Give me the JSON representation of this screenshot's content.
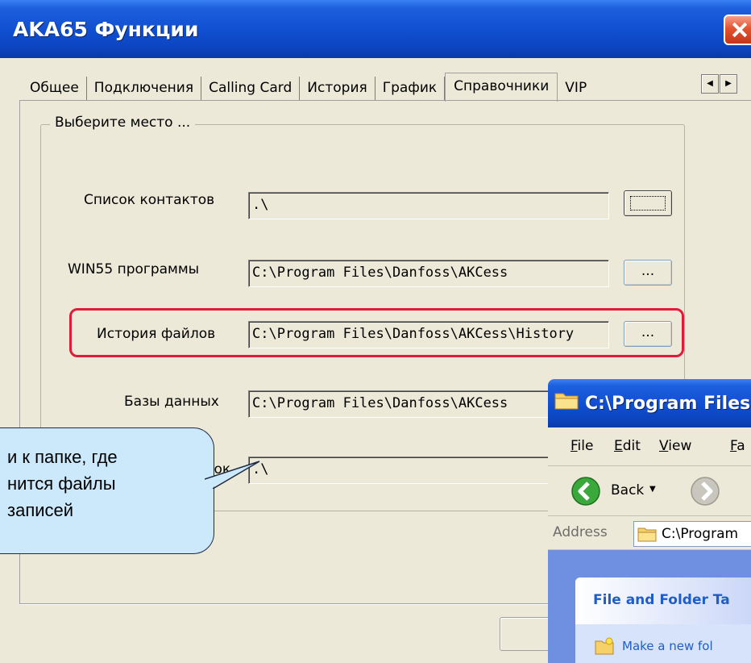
{
  "dialog": {
    "title": "AKA65 Функции",
    "tabs": [
      "Общее",
      "Подключения",
      "Calling Card",
      "История",
      "График",
      "Справочники",
      "VIP"
    ],
    "active_tab": "Справочники",
    "group_title": "Выберите место ...",
    "rows": [
      {
        "label": "Список контактов",
        "value": ".\\",
        "button": ""
      },
      {
        "label": "WIN55 программы",
        "value": "C:\\Program Files\\Danfoss\\AKCess",
        "button": "..."
      },
      {
        "label": "История файлов",
        "value": "C:\\Program Files\\Danfoss\\AKCess\\History",
        "button": "..."
      },
      {
        "label": "Базы данных",
        "value": "C:\\Program Files\\Danfoss\\AKCess",
        "button": ""
      },
      {
        "label": "писок",
        "value": ".\\",
        "button": ""
      }
    ]
  },
  "callout": {
    "lines": [
      "и к папке, где",
      "нится файлы",
      " записей"
    ],
    "color": "#cce8fb"
  },
  "explorer": {
    "title": "C:\\Program Files",
    "menu": [
      {
        "label": "File",
        "underline": "F",
        "rest": "ile"
      },
      {
        "label": "Edit",
        "underline": "E",
        "rest": "dit"
      },
      {
        "label": "View",
        "underline": "V",
        "rest": "iew"
      },
      {
        "label": "Fa",
        "underline": "F",
        "rest": "a"
      }
    ],
    "back_label": "Back",
    "address_label": "Address",
    "address_value": "C:\\Program",
    "task_title": "File and Folder Ta",
    "task_item": "Make a new fol"
  },
  "colors": {
    "title_bar": "#0f4ed0",
    "highlight": "#e21b3b",
    "window_bg": "#ece9d8"
  }
}
